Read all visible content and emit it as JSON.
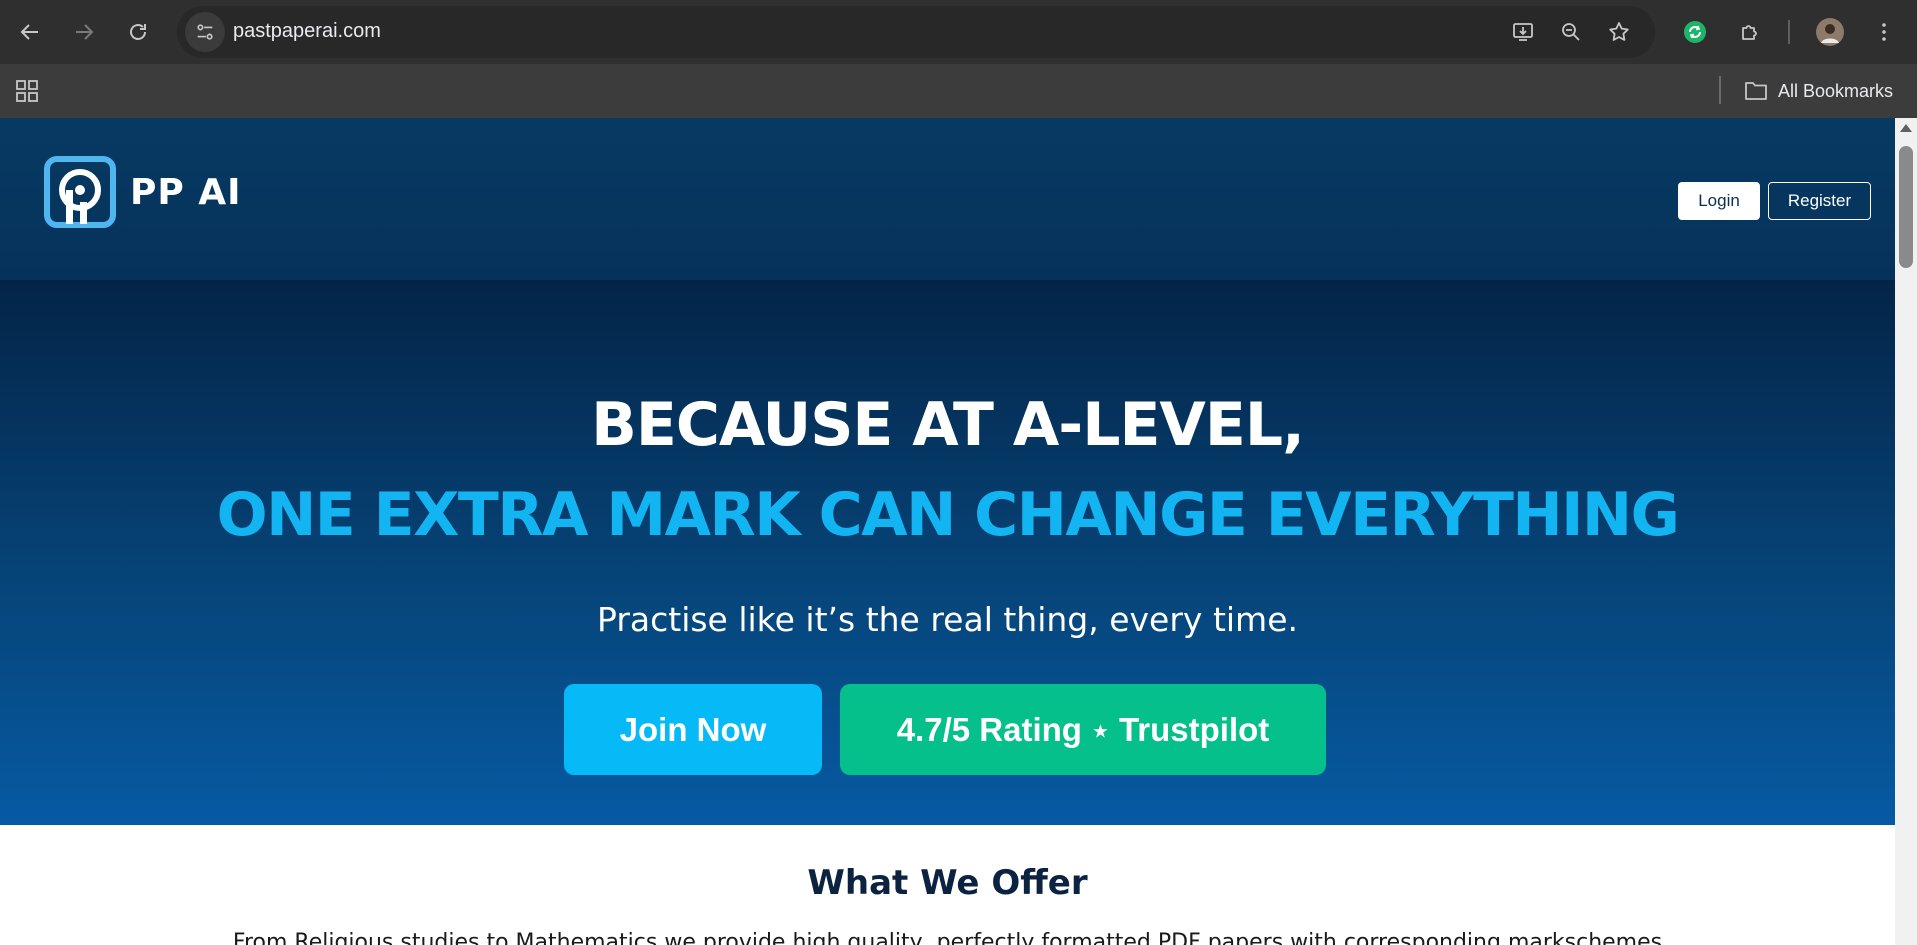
{
  "browser": {
    "url": "pastpaperai.com",
    "bookmarks_label": "All Bookmarks",
    "icons": {
      "back": "arrow-left-icon",
      "forward": "arrow-right-icon",
      "reload": "reload-icon",
      "site_info": "tune-icon",
      "install": "install-app-icon",
      "zoom": "zoom-out-icon",
      "bookmark": "star-icon",
      "extension_green": "sync-extension-icon",
      "extensions": "puzzle-icon",
      "profile": "avatar",
      "menu": "kebab-menu-icon",
      "apps": "apps-grid-icon",
      "folder": "folder-icon"
    }
  },
  "site": {
    "logo_text": "PP AI",
    "login_label": "Login",
    "register_label": "Register",
    "colors": {
      "header_bg": "#073a63",
      "accent_blue": "#06baf7",
      "accent_green": "#05c08a",
      "headline_blue": "#13b4f2"
    }
  },
  "hero": {
    "line1": "BECAUSE AT A-LEVEL,",
    "line2": "ONE EXTRA MARK CAN CHANGE EVERYTHING",
    "subtitle": "Practise like it’s the real thing, every time.",
    "join_label": "Join Now",
    "rating_text": "4.7/5 Rating",
    "rating_star": "⭑",
    "rating_source": "Trustpilot"
  },
  "offer": {
    "title": "What We Offer",
    "description": "From Religious studies to Mathematics we provide high quality, perfectly formatted PDF papers with corresponding markschemes"
  }
}
